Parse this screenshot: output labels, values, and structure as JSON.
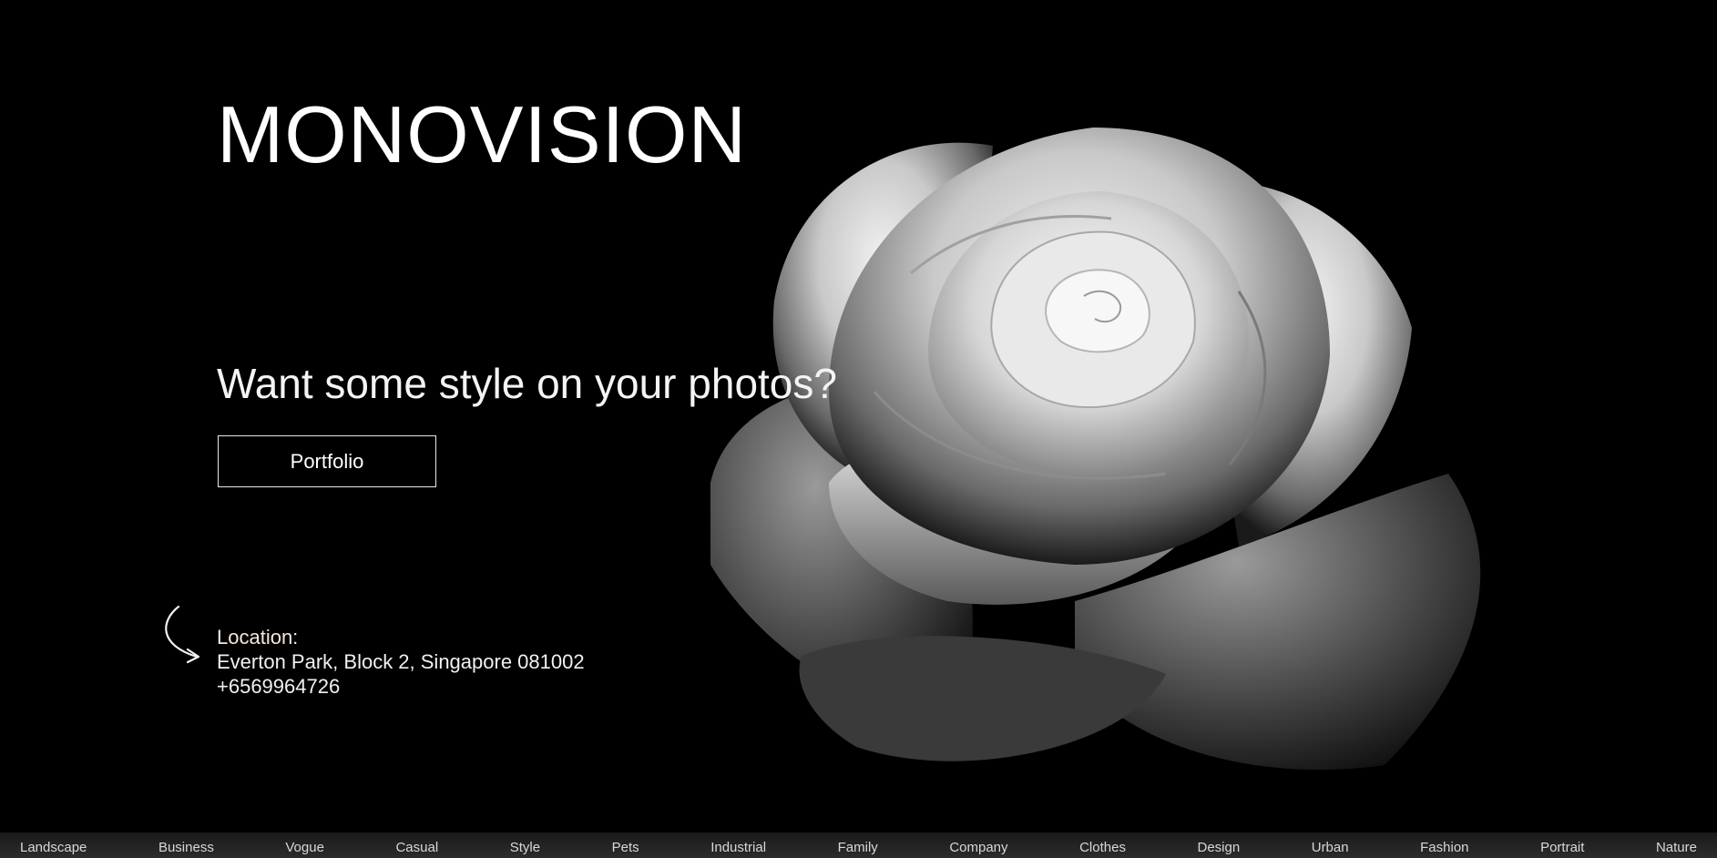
{
  "brand": {
    "name": "MONOVISION"
  },
  "hero": {
    "tagline": "Want some style on your photos?",
    "button_label": "Portfolio",
    "image_subject": "black-and-white rose"
  },
  "contact": {
    "location_label": "Location:",
    "address": "Everton Park, Block 2, Singapore 081002",
    "phone": "+6569964726",
    "arrow_icon": "curved-arrow-icon"
  },
  "categories": [
    "Landscape",
    "Business",
    "Vogue",
    "Casual",
    "Style",
    "Pets",
    "Industrial",
    "Family",
    "Company",
    "Clothes",
    "Design",
    "Urban",
    "Fashion",
    "Portrait",
    "Nature"
  ],
  "colors": {
    "background": "#000000",
    "text": "#ffffff",
    "location_label": "#f3e8de",
    "category_bar": "#222222"
  }
}
